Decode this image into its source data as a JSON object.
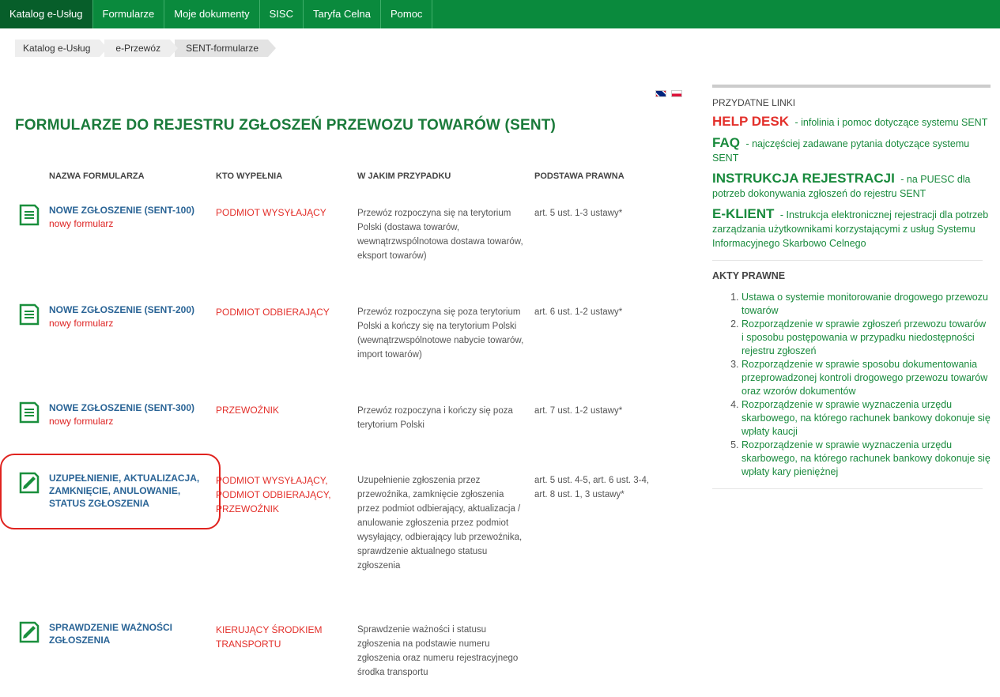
{
  "topnav": [
    "Katalog e-Usług",
    "Formularze",
    "Moje dokumenty",
    "SISC",
    "Taryfa Celna",
    "Pomoc"
  ],
  "breadcrumb": [
    "Katalog e-Usług",
    "e-Przewóz",
    "SENT-formularze"
  ],
  "title": "FORMULARZE DO REJESTRU ZGŁOSZEŃ PRZEWOZU TOWARÓW (SENT)",
  "columns": [
    "NAZWA FORMULARZA",
    "KTO WYPEŁNIA",
    "W JAKIM PRZYPADKU",
    "PODSTAWA PRAWNA"
  ],
  "forms": [
    {
      "name": "NOWE ZGŁOSZENIE (SENT-100)",
      "sub": "nowy formularz",
      "who": "PODMIOT WYSYŁAJĄCY",
      "when": "Przewóz rozpoczyna się na terytorium Polski (dostawa towarów, wewnątrzwspólnotowa dostawa towarów, eksport towarów)",
      "law": "art. 5 ust. 1-3 ustawy*",
      "icon": "document-icon"
    },
    {
      "name": "NOWE ZGŁOSZENIE (SENT-200)",
      "sub": "nowy formularz",
      "who": "PODMIOT ODBIERAJĄCY",
      "when": "Przewóz rozpoczyna się poza terytorium Polski a kończy się na terytorium Polski (wewnątrzwspólnotowe nabycie towarów, import towarów)",
      "law": "art. 6 ust. 1-2 ustawy*",
      "icon": "document-icon"
    },
    {
      "name": "NOWE ZGŁOSZENIE (SENT-300)",
      "sub": "nowy formularz",
      "who": "PRZEWOŹNIK",
      "when": "Przewóz rozpoczyna i kończy się poza terytorium Polski",
      "law": "art. 7 ust. 1-2 ustawy*",
      "icon": "document-icon"
    },
    {
      "name": "UZUPEŁNIENIE, AKTUALIZACJA, ZAMKNIĘCIE, ANULOWANIE, STATUS ZGŁOSZENIA",
      "sub": "",
      "who": "PODMIOT WYSYŁAJĄCY, PODMIOT ODBIERAJĄCY, PRZEWOŹNIK",
      "when": "Uzupełnienie zgłoszenia przez przewoźnika, zamknięcie zgłoszenia przez podmiot odbierający, aktualizacja / anulowanie zgłoszenia przez podmiot wysyłający, odbierający lub przewoźnika, sprawdzenie aktualnego statusu zgłoszenia",
      "law": "art. 5 ust. 4-5, art. 6 ust. 3-4, art. 8 ust. 1, 3 ustawy*",
      "icon": "edit-document-icon"
    },
    {
      "name": "SPRAWDZENIE WAŻNOŚCI ZGŁOSZENIA",
      "sub": "",
      "who": "KIERUJĄCY ŚRODKIEM TRANSPORTU",
      "when": "Sprawdzenie ważności i statusu zgłoszenia na podstawie numeru zgłoszenia oraz numeru rejestracyjnego środka transportu",
      "law": "",
      "icon": "edit-document-icon"
    }
  ],
  "sidebar": {
    "title": "PRZYDATNE LINKI",
    "links": [
      {
        "big": "HELP DESK",
        "text": "- infolinia i pomoc dotyczące systemu SENT",
        "color": "#e3302b"
      },
      {
        "big": "FAQ",
        "text": "- najczęściej zadawane pytania dotyczące systemu SENT",
        "color": "#198a3d"
      },
      {
        "big": "INSTRUKCJA REJESTRACJI",
        "text": "- na PUESC dla potrzeb dokonywania zgłoszeń do rejestru SENT",
        "color": "#198a3d"
      },
      {
        "big": "E-KLIENT",
        "text": "- Instrukcja elektronicznej rejestracji dla potrzeb zarządzania użytkownikami korzystającymi z usług Systemu Informacyjnego Skarbowo Celnego",
        "color": "#198a3d"
      }
    ],
    "akty_title": "AKTY PRAWNE",
    "akty": [
      "Ustawa o systemie monitorowanie drogowego przewozu towarów",
      "Rozporządzenie w sprawie zgłoszeń przewozu towarów i sposobu postępowania w przypadku niedostępności rejestru zgłoszeń",
      "Rozporządzenie w sprawie sposobu dokumentowania przeprowadzonej kontroli drogowego przewozu towarów oraz wzorów dokumentów",
      "Rozporządzenie w sprawie wyznaczenia urzędu skarbowego, na którego rachunek bankowy dokonuje się wpłaty kaucji",
      "Rozporządzenie w sprawie wyznaczenia urzędu skarbowego, na którego rachunek bankowy dokonuje się wpłaty kary pieniężnej"
    ]
  }
}
